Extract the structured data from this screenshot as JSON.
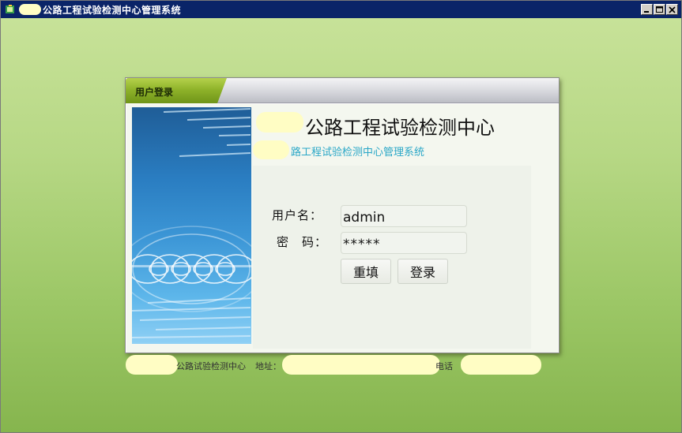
{
  "window": {
    "title": "公路工程试验检测中心管理系统",
    "controls": [
      "minimize",
      "maximize",
      "close"
    ]
  },
  "panel": {
    "tab_label": "用户登录",
    "org_name": "公路工程试验检测中心",
    "system_name": "路工程试验检测中心管理系统"
  },
  "form": {
    "username_label": "用户名：",
    "username_value": "admin",
    "password_label": "密　码：",
    "password_value": "*****",
    "reset_label": "重填",
    "login_label": "登录"
  },
  "footer": {
    "org": "公路试验检测中心",
    "address_label": "地址：",
    "phone_label": "电话"
  },
  "colors": {
    "titlebar": "#0a2468",
    "background_top": "#c9e39b",
    "background_bottom": "#86b54e",
    "tab_green": "#8fb32a",
    "system_name": "#2aa7c7"
  },
  "icons": {
    "app": "app-icon",
    "minimize": "minimize-icon",
    "maximize": "maximize-icon",
    "close": "close-icon"
  }
}
